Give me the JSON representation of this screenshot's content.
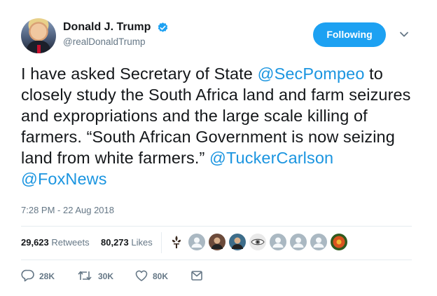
{
  "header": {
    "display_name": "Donald J. Trump",
    "handle": "@realDonaldTrump",
    "follow_label": "Following",
    "accent": "#1da1f2"
  },
  "tweet": {
    "segments": [
      {
        "text": "I have asked Secretary of State ",
        "mention": false
      },
      {
        "text": "@SecPompeo",
        "mention": true
      },
      {
        "text": " to closely study the South Africa land and farm seizures and expropriations and the large scale killing of farmers. “South African Government is now seizing land from white farmers.” ",
        "mention": false
      },
      {
        "text": "@TuckerCarlson",
        "mention": true
      },
      {
        "text": " ",
        "mention": false
      },
      {
        "text": "@FoxNews",
        "mention": true
      }
    ],
    "timestamp": "7:28 PM - 22 Aug 2018"
  },
  "stats": {
    "retweets_count": "29,623",
    "retweets_label": "Retweets",
    "likes_count": "80,273",
    "likes_label": "Likes"
  },
  "likers": [
    {
      "icon": "fleur-de-lis-icon",
      "color": "#3a2a20"
    },
    {
      "icon": "default-avatar-icon",
      "color": "#aab8c2"
    },
    {
      "icon": "user-photo-icon",
      "color": "#6b4a3a"
    },
    {
      "icon": "user-photo-icon",
      "color": "#3d6d8a"
    },
    {
      "icon": "eye-icon",
      "color": "#8a8a8a"
    },
    {
      "icon": "default-avatar-icon",
      "color": "#aab8c2"
    },
    {
      "icon": "default-avatar-icon",
      "color": "#aab8c2"
    },
    {
      "icon": "default-avatar-icon",
      "color": "#aab8c2"
    },
    {
      "icon": "flower-icon",
      "color": "#d9531e"
    }
  ],
  "actions": {
    "reply_count": "28K",
    "retweet_count": "30K",
    "like_count": "80K"
  }
}
